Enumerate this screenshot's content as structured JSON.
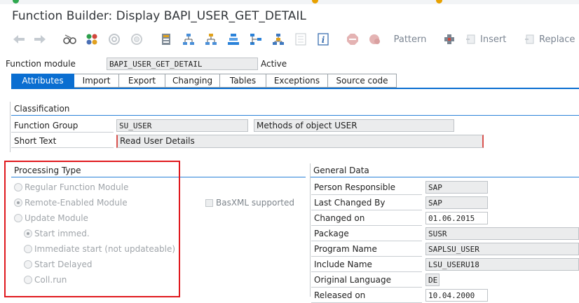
{
  "window": {
    "title": "Function Builder: Display BAPI_USER_GET_DETAIL"
  },
  "toolbar": {
    "items": [
      {
        "icon": "back-arrow-icon"
      },
      {
        "icon": "forward-arrow-icon"
      },
      {
        "icon": "display-change-glasses-icon"
      },
      {
        "icon": "other-object-icon"
      },
      {
        "icon": "check-icon"
      },
      {
        "icon": "activate-icon"
      },
      {
        "icon": "test-icon"
      },
      {
        "icon": "where-used-icon"
      },
      {
        "icon": "hierarchy-icon"
      },
      {
        "icon": "enhance-icon"
      },
      {
        "icon": "display-object-list-icon"
      },
      {
        "icon": "info-icon"
      },
      {
        "icon": "stop-icon"
      },
      {
        "icon": "breakpoint-icon"
      }
    ],
    "pattern_label": "Pattern",
    "insert_label": "Insert",
    "replace_label": "Replace"
  },
  "function_module": {
    "label": "Function module",
    "value": "BAPI_USER_GET_DETAIL",
    "status": "Active"
  },
  "tabs": [
    {
      "label": "Attributes",
      "active": true
    },
    {
      "label": "Import"
    },
    {
      "label": "Export"
    },
    {
      "label": "Changing"
    },
    {
      "label": "Tables"
    },
    {
      "label": "Exceptions"
    },
    {
      "label": "Source code"
    }
  ],
  "classification": {
    "heading": "Classification",
    "function_group_label": "Function Group",
    "function_group_value": "SU_USER",
    "function_group_desc": "Methods of object USER",
    "short_text_label": "Short Text",
    "short_text_value": "Read User Details"
  },
  "processing_type": {
    "heading": "Processing Type",
    "options": [
      {
        "label": "Regular Function Module",
        "selected": false
      },
      {
        "label": "Remote-Enabled Module",
        "selected": true
      },
      {
        "label": "Update Module",
        "selected": false
      }
    ],
    "update_options": [
      {
        "label": "Start immed.",
        "selected": true
      },
      {
        "label": "Immediate start (not updateable)",
        "selected": false
      },
      {
        "label": "Start Delayed",
        "selected": false
      },
      {
        "label": "Coll.run",
        "selected": false
      }
    ],
    "basxml_label": "BasXML supported"
  },
  "general_data": {
    "heading": "General Data",
    "rows": [
      {
        "label": "Person Responsible",
        "value": "SAP"
      },
      {
        "label": "Last Changed By",
        "value": "SAP"
      },
      {
        "label": "Changed on",
        "value": "01.06.2015"
      },
      {
        "label": "Package",
        "value": "SUSR"
      },
      {
        "label": "Program Name",
        "value": "SAPLSU_USER"
      },
      {
        "label": "Include Name",
        "value": "LSU_USERU18"
      },
      {
        "label": "Original Language",
        "value": "DE"
      },
      {
        "label": "Released on",
        "value": "10.04.2000"
      }
    ]
  },
  "colors": {
    "accent": "#0a6ed1",
    "highlight_box": "#e0191e"
  }
}
